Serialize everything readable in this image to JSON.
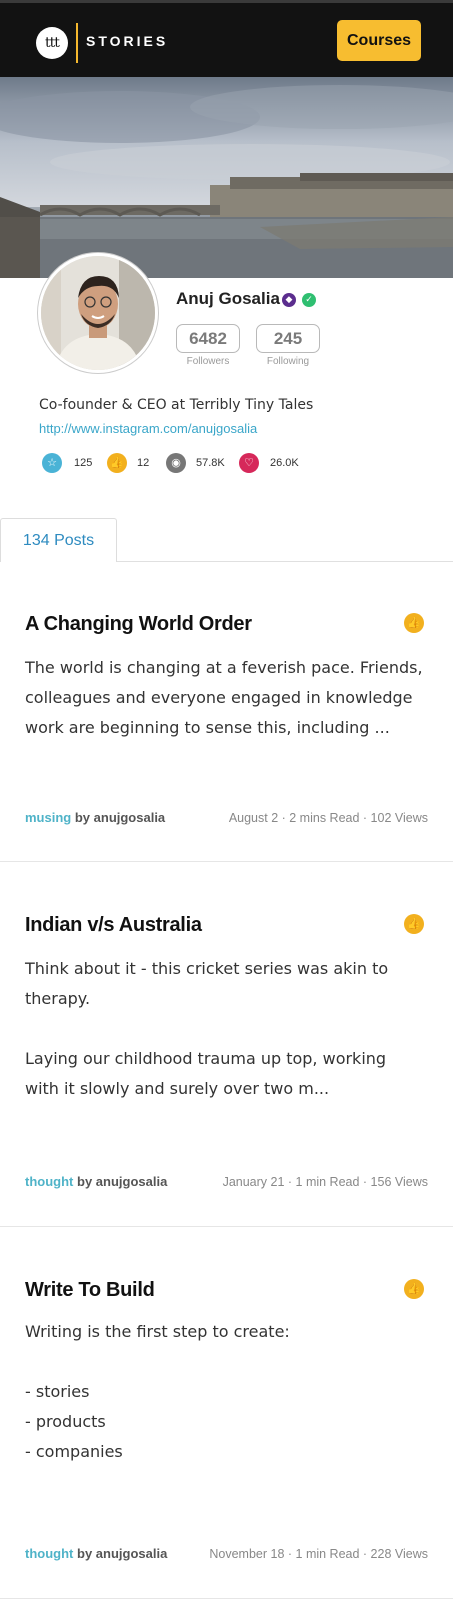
{
  "header": {
    "logo_text": "ttt",
    "brand": "STORIES",
    "courses_label": "Courses"
  },
  "profile": {
    "name": "Anuj Gosalia",
    "followers": "6482",
    "followers_label": "Followers",
    "following": "245",
    "following_label": "Following",
    "bio": "Co-founder & CEO at Terribly Tiny Tales",
    "link": "http://www.instagram.com/anujgosalia",
    "stats": [
      {
        "icon": "star-icon",
        "value": "125",
        "color": "#4ab3d6"
      },
      {
        "icon": "thumbs-up-icon",
        "value": "12",
        "color": "#f2b01e"
      },
      {
        "icon": "eye-icon",
        "value": "57.8K",
        "color": "#777777"
      },
      {
        "icon": "heart-icon",
        "value": "26.0K",
        "color": "#d6285a"
      }
    ]
  },
  "tabs": {
    "posts_label": "134 Posts"
  },
  "posts": [
    {
      "title": "A Changing World Order",
      "body": "The world is changing at a feverish pace. Friends, colleagues and everyone engaged in knowledge work are beginning to sense this, including ...",
      "category": "musing",
      "author": "by anujgosalia",
      "meta": "August 2 · 2 mins Read · 102 Views"
    },
    {
      "title": "Indian v/s Australia",
      "body": "Think about it - this cricket series was akin to therapy.\n\nLaying our childhood trauma up top, working with it slowly and surely over two m...",
      "category": "thought",
      "author": "by anujgosalia",
      "meta": "January 21 · 1 min Read · 156 Views"
    },
    {
      "title": "Write To Build",
      "body": "Writing is the first step to create:\n\n- stories\n- products\n- companies",
      "category": "thought",
      "author": "by anujgosalia",
      "meta": "November 18 · 1 min Read · 228 Views"
    }
  ],
  "colors": {
    "accent_yellow": "#f7bd30",
    "link_blue": "#3aa6c9",
    "tab_blue": "#2e8bc0",
    "category_teal": "#4fb3c8"
  }
}
